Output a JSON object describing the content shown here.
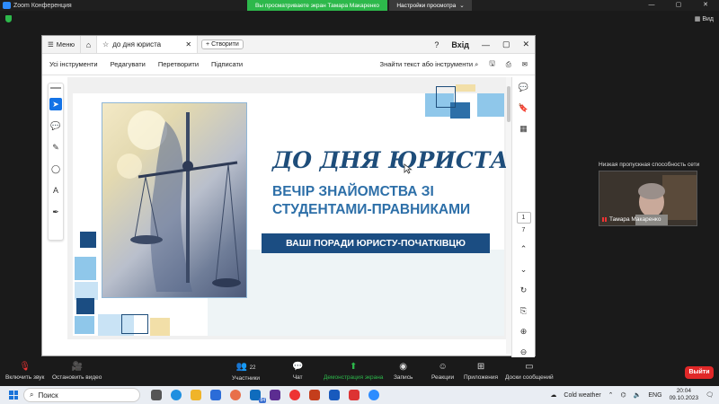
{
  "zoom": {
    "title": "Zoom Конференция",
    "share_banner": "Вы просматриваете экран Тамара Макаренко",
    "view_options": "Настройки просмотра",
    "view_button": "Вид",
    "network_warning": "Низкая пропускная способность сети",
    "participant_name": "Тамара Макаренко",
    "participant_count": "22",
    "toolbar": {
      "mute": "Включить звук",
      "video": "Остановить видео",
      "participants": "Участники",
      "chat": "Чат",
      "share": "Демонстрация экрана",
      "record": "Запись",
      "reactions": "Реакции",
      "apps": "Приложения",
      "whiteboard": "Доски сообщений",
      "leave": "Выйти"
    },
    "colors": {
      "share_green": "#2db84b",
      "leave_red": "#e02828",
      "brand_blue": "#2d8cff"
    }
  },
  "acrobat": {
    "menu": "Меню",
    "doc_tab": "до дня юриста",
    "new_tab": "Створити",
    "login": "Вхід",
    "toolbar": [
      "Усі інструменти",
      "Редагувати",
      "Перетворити",
      "Підписати"
    ],
    "search": "Знайти текст або інструменти",
    "page_current": "1",
    "page_total": "7"
  },
  "slide": {
    "title": "ДО ДНЯ ЮРИСТА:",
    "subtitle_line1": "ВЕЧІР ЗНАЙОМСТВА ЗІ",
    "subtitle_line2": "СТУДЕНТАМИ-ПРАВНИКАМИ",
    "band": "ВАШІ ПОРАДИ ЮРИСТУ-ПОЧАТКІВЦЮ",
    "colors": {
      "title": "#1e4d7a",
      "subtitle": "#2d6fa8",
      "band": "#1b4d82",
      "light_blue": "#8fc7ea",
      "sand": "#f2dfa8"
    }
  },
  "taskbar": {
    "search": "Поиск",
    "weather": "Cold weather",
    "language": "ENG",
    "time": "20:04",
    "date": "09.10.2023",
    "mail_badge": "84"
  }
}
